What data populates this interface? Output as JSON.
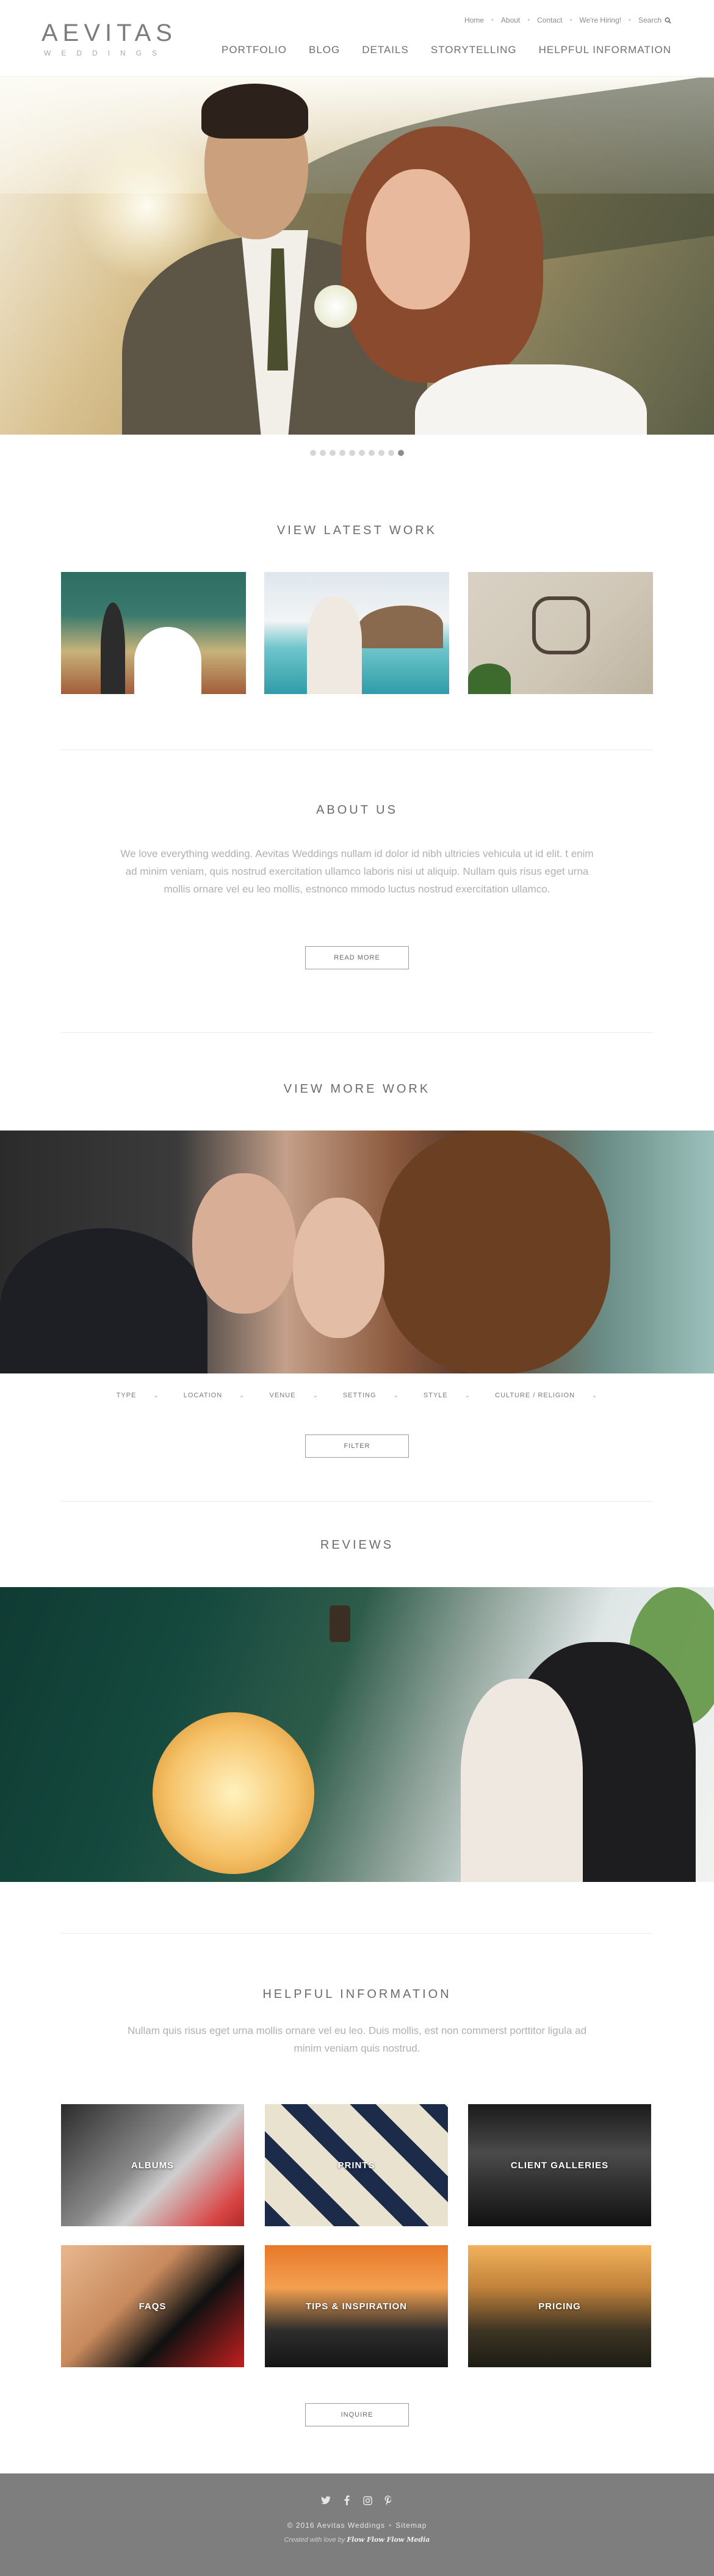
{
  "brand": {
    "name": "AEVITAS",
    "tagline": "WEDDINGS"
  },
  "util_nav": {
    "home": "Home",
    "about": "About",
    "contact": "Contact",
    "hiring": "We're Hiring!",
    "search": "Search"
  },
  "main_nav": [
    "PORTFOLIO",
    "BLOG",
    "DETAILS",
    "STORYTELLING",
    "HELPFUL INFORMATION"
  ],
  "slider": {
    "total_dots": 10,
    "active_dot": 10
  },
  "latest_work": {
    "title": "VIEW LATEST WORK"
  },
  "about": {
    "title": "ABOUT US",
    "body": "We love everything wedding. Aevitas Weddings nullam id dolor id nibh ultricies vehicula ut id elit. t enim ad minim veniam, quis nostrud exercitation ullamco laboris nisi ut aliquip. Nullam quis risus eget urna mollis ornare vel eu leo mollis, estnonco mmodo luctus nostrud exercitation ullamco.",
    "button": "READ MORE"
  },
  "more_work": {
    "title": "VIEW MORE WORK",
    "filters": [
      "TYPE",
      "LOCATION",
      "VENUE",
      "SETTING",
      "STYLE",
      "CULTURE / RELIGION"
    ],
    "button": "FILTER"
  },
  "reviews": {
    "title": "REVIEWS"
  },
  "helpful": {
    "title": "HELPFUL INFORMATION",
    "body": "Nullam quis risus eget urna mollis ornare vel eu leo. Duis mollis, est non commerst porttitor ligula ad minim veniam quis nostrud.",
    "tiles": [
      "ALBUMS",
      "PRINTS",
      "CLIENT GALLERIES",
      "FAQS",
      "TIPS & INSPIRATION",
      "PRICING"
    ],
    "button": "INQUIRE"
  },
  "footer": {
    "social": [
      "twitter-icon",
      "facebook-icon",
      "instagram-icon",
      "pinterest-icon"
    ],
    "copyright": "© 2016 Aevitas Weddings",
    "sitemap": "Sitemap",
    "credit_prefix": "Created with love by",
    "credit_name": "Flow Flow Flow Media"
  }
}
